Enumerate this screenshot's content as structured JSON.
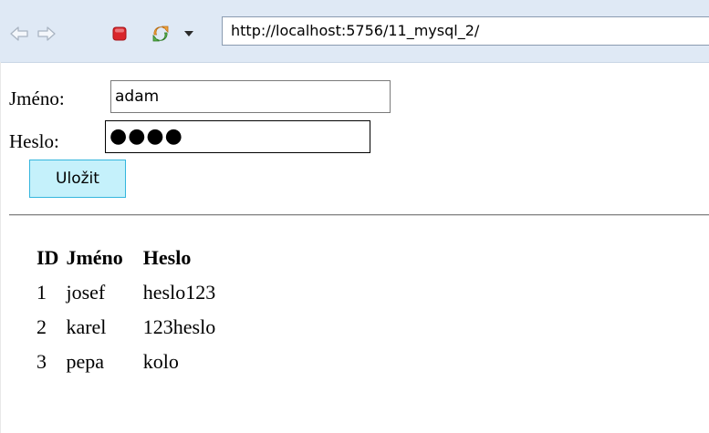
{
  "browser": {
    "back_icon": "back-arrow-icon",
    "forward_icon": "forward-arrow-icon",
    "stop_icon": "stop-icon",
    "refresh_icon": "refresh-icon",
    "url": "http://localhost:5756/11_mysql_2/"
  },
  "form": {
    "name_label": "Jméno:",
    "name_value": "adam",
    "password_label": "Heslo:",
    "password_masked": "●●●●",
    "save_label": "Uložit"
  },
  "table": {
    "headers": [
      "ID",
      "Jméno",
      "Heslo"
    ],
    "rows": [
      [
        "1",
        "josef",
        "heslo123"
      ],
      [
        "2",
        "karel",
        "123heslo"
      ],
      [
        "3",
        "pepa",
        "kolo"
      ]
    ]
  },
  "colors": {
    "toolbar_bg": "#dfe9f5",
    "button_bg": "#c5f1fb",
    "button_border": "#34b6dd",
    "stop_red": "#d9252a"
  }
}
